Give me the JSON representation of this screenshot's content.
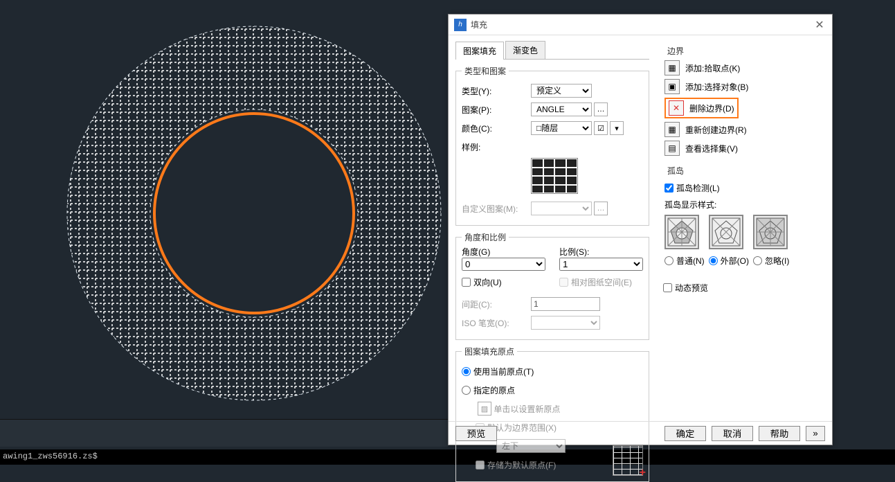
{
  "statusbar": "awing1_zws56916.zs$",
  "dialog": {
    "title": "填充",
    "tabs": {
      "pattern": "图案填充",
      "gradient": "渐变色"
    },
    "type_group": {
      "legend": "类型和图案",
      "type_label": "类型(Y):",
      "type_value": "预定义",
      "pattern_label": "图案(P):",
      "pattern_value": "ANGLE",
      "color_label": "颜色(C):",
      "color_value": "□随层",
      "sample_label": "样例:",
      "custom_label": "自定义图案(M):"
    },
    "angle_group": {
      "legend": "角度和比例",
      "angle_label": "角度(G)",
      "angle_value": "0",
      "scale_label": "比例(S):",
      "scale_value": "1",
      "bidir_label": "双向(U)",
      "paperspace_label": "相对图纸空间(E)",
      "spacing_label": "间距(C):",
      "spacing_value": "1",
      "iso_label": "ISO 笔宽(O):"
    },
    "origin_group": {
      "legend": "图案填充原点",
      "use_current": "使用当前原点(T)",
      "specified": "指定的原点",
      "click_new": "单击以设置新原点",
      "default_bounds": "默认为边界范围(X)",
      "pos_value": "左下",
      "store_default": "存储为默认原点(F)"
    },
    "boundary_group": {
      "legend": "边界",
      "add_pick": "添加:拾取点(K)",
      "add_select": "添加:选择对象(B)",
      "remove": "删除边界(D)",
      "recreate": "重新创建边界(R)",
      "view_sel": "查看选择集(V)"
    },
    "island_group": {
      "legend": "孤岛",
      "detect_label": "孤岛检测(L)",
      "style_label": "孤岛显示样式:",
      "normal": "普通(N)",
      "outer": "外部(O)",
      "ignore": "忽略(I)"
    },
    "dynamic_preview": "动态预览",
    "footer": {
      "preview": "预览",
      "ok": "确定",
      "cancel": "取消",
      "help": "帮助",
      "more": "»"
    }
  }
}
